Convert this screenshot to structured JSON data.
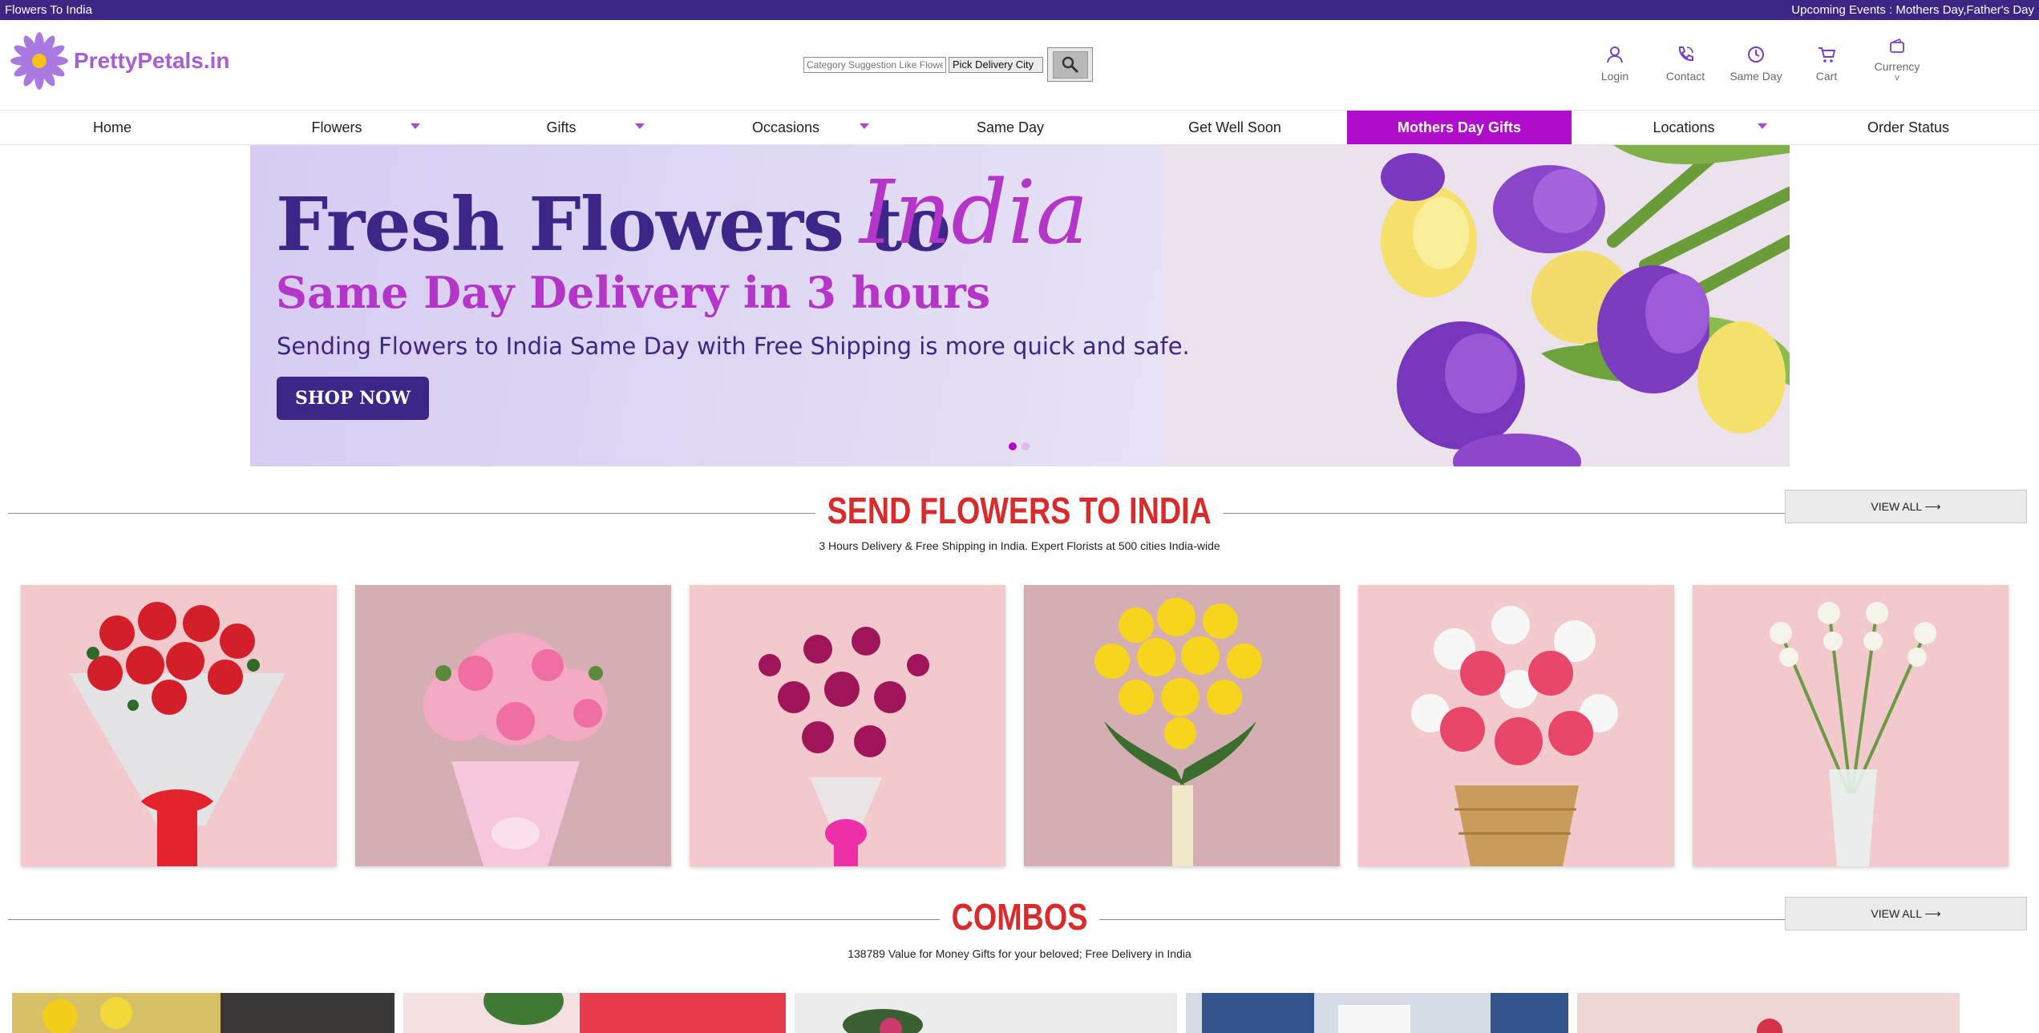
{
  "topbar": {
    "left_text": "Flowers To India",
    "right_text": "Upcoming Events : Mothers Day,Father's Day"
  },
  "header": {
    "logo_text": "PrettyPetals.in",
    "search": {
      "placeholder": "Category Suggestion Like Flowers",
      "city_label": "Pick Delivery City"
    },
    "icons": [
      {
        "label": "Login",
        "icon": "user-icon"
      },
      {
        "label": "Contact",
        "icon": "phone-icon"
      },
      {
        "label": "Same Day",
        "icon": "clock-icon"
      },
      {
        "label": "Cart",
        "icon": "cart-icon"
      },
      {
        "label": "Currency",
        "icon": "wallet-icon",
        "sub": "v"
      }
    ]
  },
  "nav": {
    "items": [
      {
        "label": "Home",
        "dropdown": false
      },
      {
        "label": "Flowers",
        "dropdown": true
      },
      {
        "label": "Gifts",
        "dropdown": true
      },
      {
        "label": "Occasions",
        "dropdown": true
      },
      {
        "label": "Same Day",
        "dropdown": false
      },
      {
        "label": "Get Well Soon",
        "dropdown": false
      },
      {
        "label": "Mothers Day Gifts",
        "dropdown": false,
        "active": true
      },
      {
        "label": "Locations",
        "dropdown": true
      },
      {
        "label": "Order Status",
        "dropdown": false
      }
    ],
    "active_color": "#b00ccc"
  },
  "hero": {
    "title": "Fresh Flowers to",
    "title_script": "India",
    "subtitle": "Same Day Delivery in 3 hours",
    "description": "Sending Flowers to India Same Day with Free Shipping is more quick and safe.",
    "button": "SHOP NOW",
    "slide_count": 2,
    "active_slide": 1
  },
  "sections": {
    "flowers": {
      "title": "SEND FLOWERS TO INDIA",
      "subtitle": "3 Hours Delivery & Free Shipping in India. Expert Florists at 500 cities India-wide",
      "view_all": "VIEW ALL ⟶"
    },
    "combos": {
      "title": "COMBOS",
      "subtitle": "138789 Value for Money Gifts for your beloved; Free Delivery in India",
      "view_all": "VIEW ALL ⟶"
    }
  },
  "colors": {
    "brand_purple": "#3b2585",
    "accent_magenta": "#b00ccc",
    "section_red": "#d92b2b",
    "card_pink": "#f2c9cc"
  }
}
